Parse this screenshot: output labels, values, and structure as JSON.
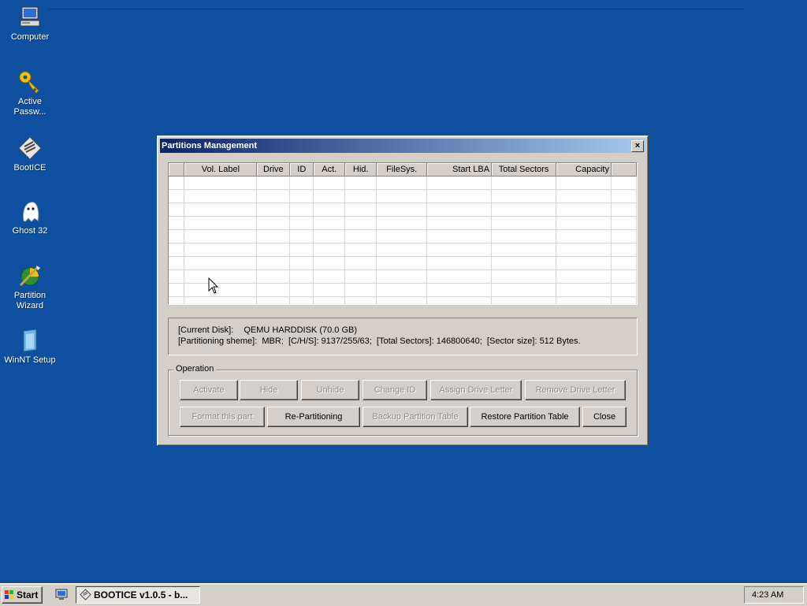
{
  "desktop": {
    "icons": [
      {
        "label": "Computer",
        "icon": "computer-icon"
      },
      {
        "label": "Active\nPassw...",
        "icon": "key-icon"
      },
      {
        "label": "BootICE",
        "icon": "bootice-icon"
      },
      {
        "label": "Ghost 32",
        "icon": "ghost-icon"
      },
      {
        "label": "Partition\nWizard",
        "icon": "partition-wizard-icon"
      },
      {
        "label": "WinNT Setup",
        "icon": "winnt-setup-icon"
      }
    ],
    "background_color": "#0e4fa0"
  },
  "dialog": {
    "title": "Partitions Management",
    "close_glyph": "×",
    "columns": [
      "Vol. Label",
      "Drive",
      "ID",
      "Act.",
      "Hid.",
      "FileSys.",
      "Start LBA",
      "Total Sectors",
      "Capacity"
    ],
    "info": {
      "current_disk_label": "[Current Disk]:",
      "current_disk_value": "QEMU HARDDISK (70.0 GB)",
      "scheme_line": "[Partitioning sheme]:  MBR;  [C/H/S]: 9137/255/63;  [Total Sectors]: 146800640;  [Sector size]: 512 Bytes."
    },
    "operation": {
      "legend": "Operation",
      "row1": [
        {
          "label": "Activate",
          "enabled": false
        },
        {
          "label": "Hide",
          "enabled": false
        },
        {
          "label": "Unhide",
          "enabled": false
        },
        {
          "label": "Change ID",
          "enabled": false
        },
        {
          "label": "Assign Drive Letter",
          "enabled": false
        },
        {
          "label": "Remove Drive Letter",
          "enabled": false
        }
      ],
      "row2": [
        {
          "label": "Format this part",
          "enabled": false
        },
        {
          "label": "Re-Partitioning",
          "enabled": true
        },
        {
          "label": "Backup Partition Table",
          "enabled": false
        },
        {
          "label": "Restore Partition Table",
          "enabled": true
        },
        {
          "label": "Close",
          "enabled": true
        }
      ]
    }
  },
  "taskbar": {
    "start_label": "Start",
    "task_label": "BOOTICE v1.0.5 - b...",
    "clock": "4:23 AM"
  }
}
